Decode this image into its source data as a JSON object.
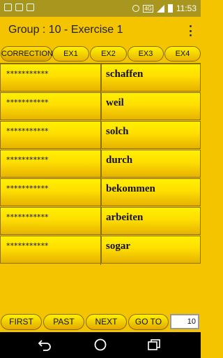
{
  "status_bar": {
    "time": "11:53",
    "network": "4G"
  },
  "app_bar": {
    "title": "Group : 10 - Exercise 1",
    "menu_icon": "overflow-menu-icon"
  },
  "tabs": [
    {
      "label": "CORRECTION"
    },
    {
      "label": "EX1"
    },
    {
      "label": "EX2"
    },
    {
      "label": "EX3"
    },
    {
      "label": "EX4"
    }
  ],
  "rows": [
    {
      "left": "***********",
      "right": "schaffen"
    },
    {
      "left": "***********",
      "right": "weil"
    },
    {
      "left": "***********",
      "right": "solch"
    },
    {
      "left": "***********",
      "right": "durch"
    },
    {
      "left": "***********",
      "right": "bekommen"
    },
    {
      "left": "***********",
      "right": "arbeiten"
    },
    {
      "left": "***********",
      "right": "sogar"
    }
  ],
  "bottom": {
    "first": "FIRST",
    "past": "PAST",
    "next": "NEXT",
    "goto": "GO TO",
    "goto_value": "10"
  },
  "colors": {
    "background": "#f5c400",
    "status_bar": "#a9961f",
    "nav_bar": "#000000"
  }
}
